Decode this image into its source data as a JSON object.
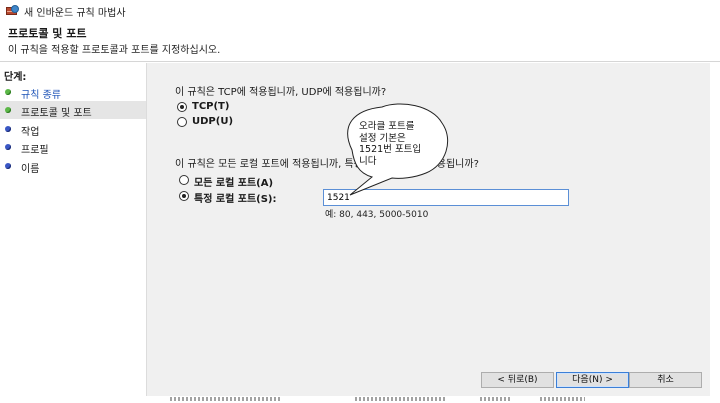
{
  "window": {
    "title": "새 인바운드 규칙 마법사"
  },
  "header": {
    "title": "프로토콜 및 포트",
    "subtitle": "이 규칙을 적용할 프로토콜과 포트를 지정하십시오."
  },
  "steps": {
    "title": "단계:",
    "items": [
      {
        "label": "규칙 종류",
        "state": "done"
      },
      {
        "label": "프로토콜 및 포트",
        "state": "current"
      },
      {
        "label": "작업",
        "state": "pending"
      },
      {
        "label": "프로필",
        "state": "pending"
      },
      {
        "label": "이름",
        "state": "pending"
      }
    ]
  },
  "protocol": {
    "question": "이 규칙은 TCP에 적용됩니까, UDP에 적용됩니까?",
    "options": [
      {
        "label": "TCP(T)",
        "checked": true
      },
      {
        "label": "UDP(U)",
        "checked": false
      }
    ]
  },
  "ports": {
    "question": "이 규칙은 모든 로컬 포트에 적용됩니까, 특정 로컬 포트에만 적용됩니까?",
    "options": [
      {
        "label": "모든 로컬 포트(A)",
        "checked": false
      },
      {
        "label": "특정 로컬 포트(S):",
        "checked": true
      }
    ],
    "input_value": "1521",
    "example": "예: 80, 443, 5000-5010"
  },
  "annotation": {
    "lines": [
      "오라클 포트를",
      "설정 기본은",
      "1521번 포트입",
      "니다"
    ]
  },
  "buttons": {
    "back": "< 뒤로(B)",
    "next": "다음(N) >",
    "cancel": "취소"
  },
  "colors": {
    "step_done": "#5cb848",
    "step_pending": "#3a57c5",
    "link": "#1f55b8",
    "content_bg": "#f0f0f0",
    "focus_border": "#5b8fd6"
  }
}
